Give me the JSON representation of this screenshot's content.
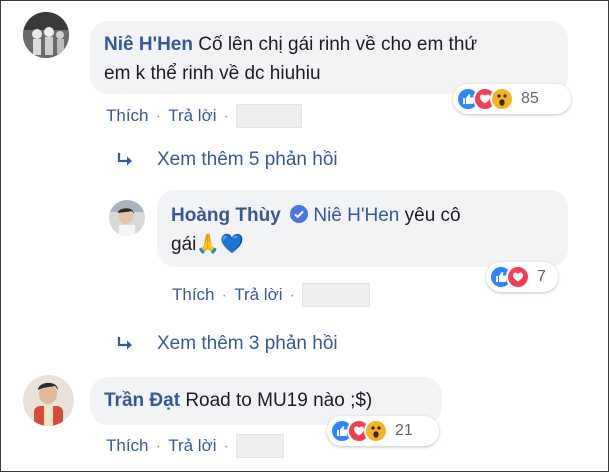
{
  "comments": [
    {
      "author": "Niê H'Hen",
      "line1": "Cố lên chị gái rinh về cho em thứ",
      "line2": "em k thể rinh về dc hiuhiu",
      "like": "Thích",
      "reply": "Trả lời",
      "reaction_count": "85",
      "reactions": [
        "like-icon",
        "love-icon",
        "wow-icon"
      ]
    },
    {
      "author": "Hoàng Thùy",
      "mention": "Niê H'Hen",
      "line1": " yêu cô",
      "line2": "gái",
      "emoji": "🙏💙",
      "like": "Thích",
      "reply": "Trả lời",
      "reaction_count": "7",
      "reactions": [
        "like-icon",
        "love-icon"
      ]
    },
    {
      "author": "Trần Đạt",
      "line1": "Road to MU19 nào ;$)",
      "like": "Thích",
      "reply": "Trả lời",
      "reaction_count": "21",
      "reactions": [
        "like-icon",
        "love-icon",
        "wow-icon"
      ]
    }
  ],
  "view_more": [
    "Xem thêm 5 phản hồi",
    "Xem thêm 3 phản hồi"
  ],
  "separator": "·",
  "colors": {
    "link": "#385898",
    "bubble": "#f2f3f5",
    "like": "#2d86ff",
    "love": "#f33e58",
    "wow": "#f7b125"
  }
}
